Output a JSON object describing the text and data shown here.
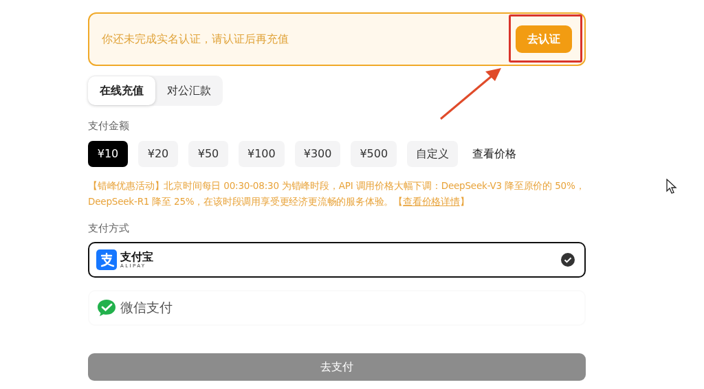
{
  "verification_banner": {
    "message": "你还未完成实名认证，请认证后再充值",
    "button": "去认证",
    "highlighted": true
  },
  "tabs": [
    {
      "label": "在线充值",
      "selected": true
    },
    {
      "label": "对公汇款",
      "selected": false
    }
  ],
  "amount_label": "支付金额",
  "amounts": [
    {
      "label": "¥10",
      "kind": "option",
      "selected": true
    },
    {
      "label": "¥20",
      "kind": "option",
      "selected": false
    },
    {
      "label": "¥50",
      "kind": "option",
      "selected": false
    },
    {
      "label": "¥100",
      "kind": "option",
      "selected": false
    },
    {
      "label": "¥300",
      "kind": "option",
      "selected": false
    },
    {
      "label": "¥500",
      "kind": "option",
      "selected": false
    },
    {
      "label": "自定义",
      "kind": "option",
      "selected": false
    },
    {
      "label": "查看价格",
      "kind": "link"
    }
  ],
  "notice": {
    "text": "【错峰优惠活动】北京时间每日 00:30-08:30 为错峰时段，API 调用价格大幅下调：DeepSeek-V3 降至原价的 50%，DeepSeek-R1 降至 25%，在该时段调用享受更经济更流畅的服务体验。【",
    "link": "查看价格详情",
    "after": "】"
  },
  "method_label": "支付方式",
  "methods": [
    {
      "kind": "alipay",
      "name": "支付宝",
      "subtitle": "ALIPAY",
      "selected": true
    },
    {
      "kind": "wechat",
      "name": "微信支付",
      "selected": false
    }
  ],
  "pay_button": {
    "label": "去支付",
    "disabled": true
  }
}
